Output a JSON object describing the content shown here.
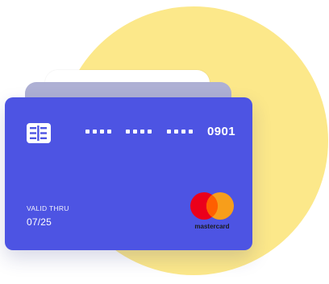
{
  "card": {
    "number_last4": "0901",
    "valid_label": "VALID THRU",
    "valid_date": "07/25",
    "brand": "mastercard"
  },
  "colors": {
    "background": "#ffffff",
    "blob": "#fce88a",
    "card_back_gray": "#aeb0d4",
    "card": "#4d54e3",
    "mastercard_red": "#eb001b",
    "mastercard_yellow": "#f79e1b",
    "mastercard_overlap": "#ff5f00"
  },
  "icons": {
    "chip": "card-chip-icon",
    "logo": "mastercard-logo"
  }
}
